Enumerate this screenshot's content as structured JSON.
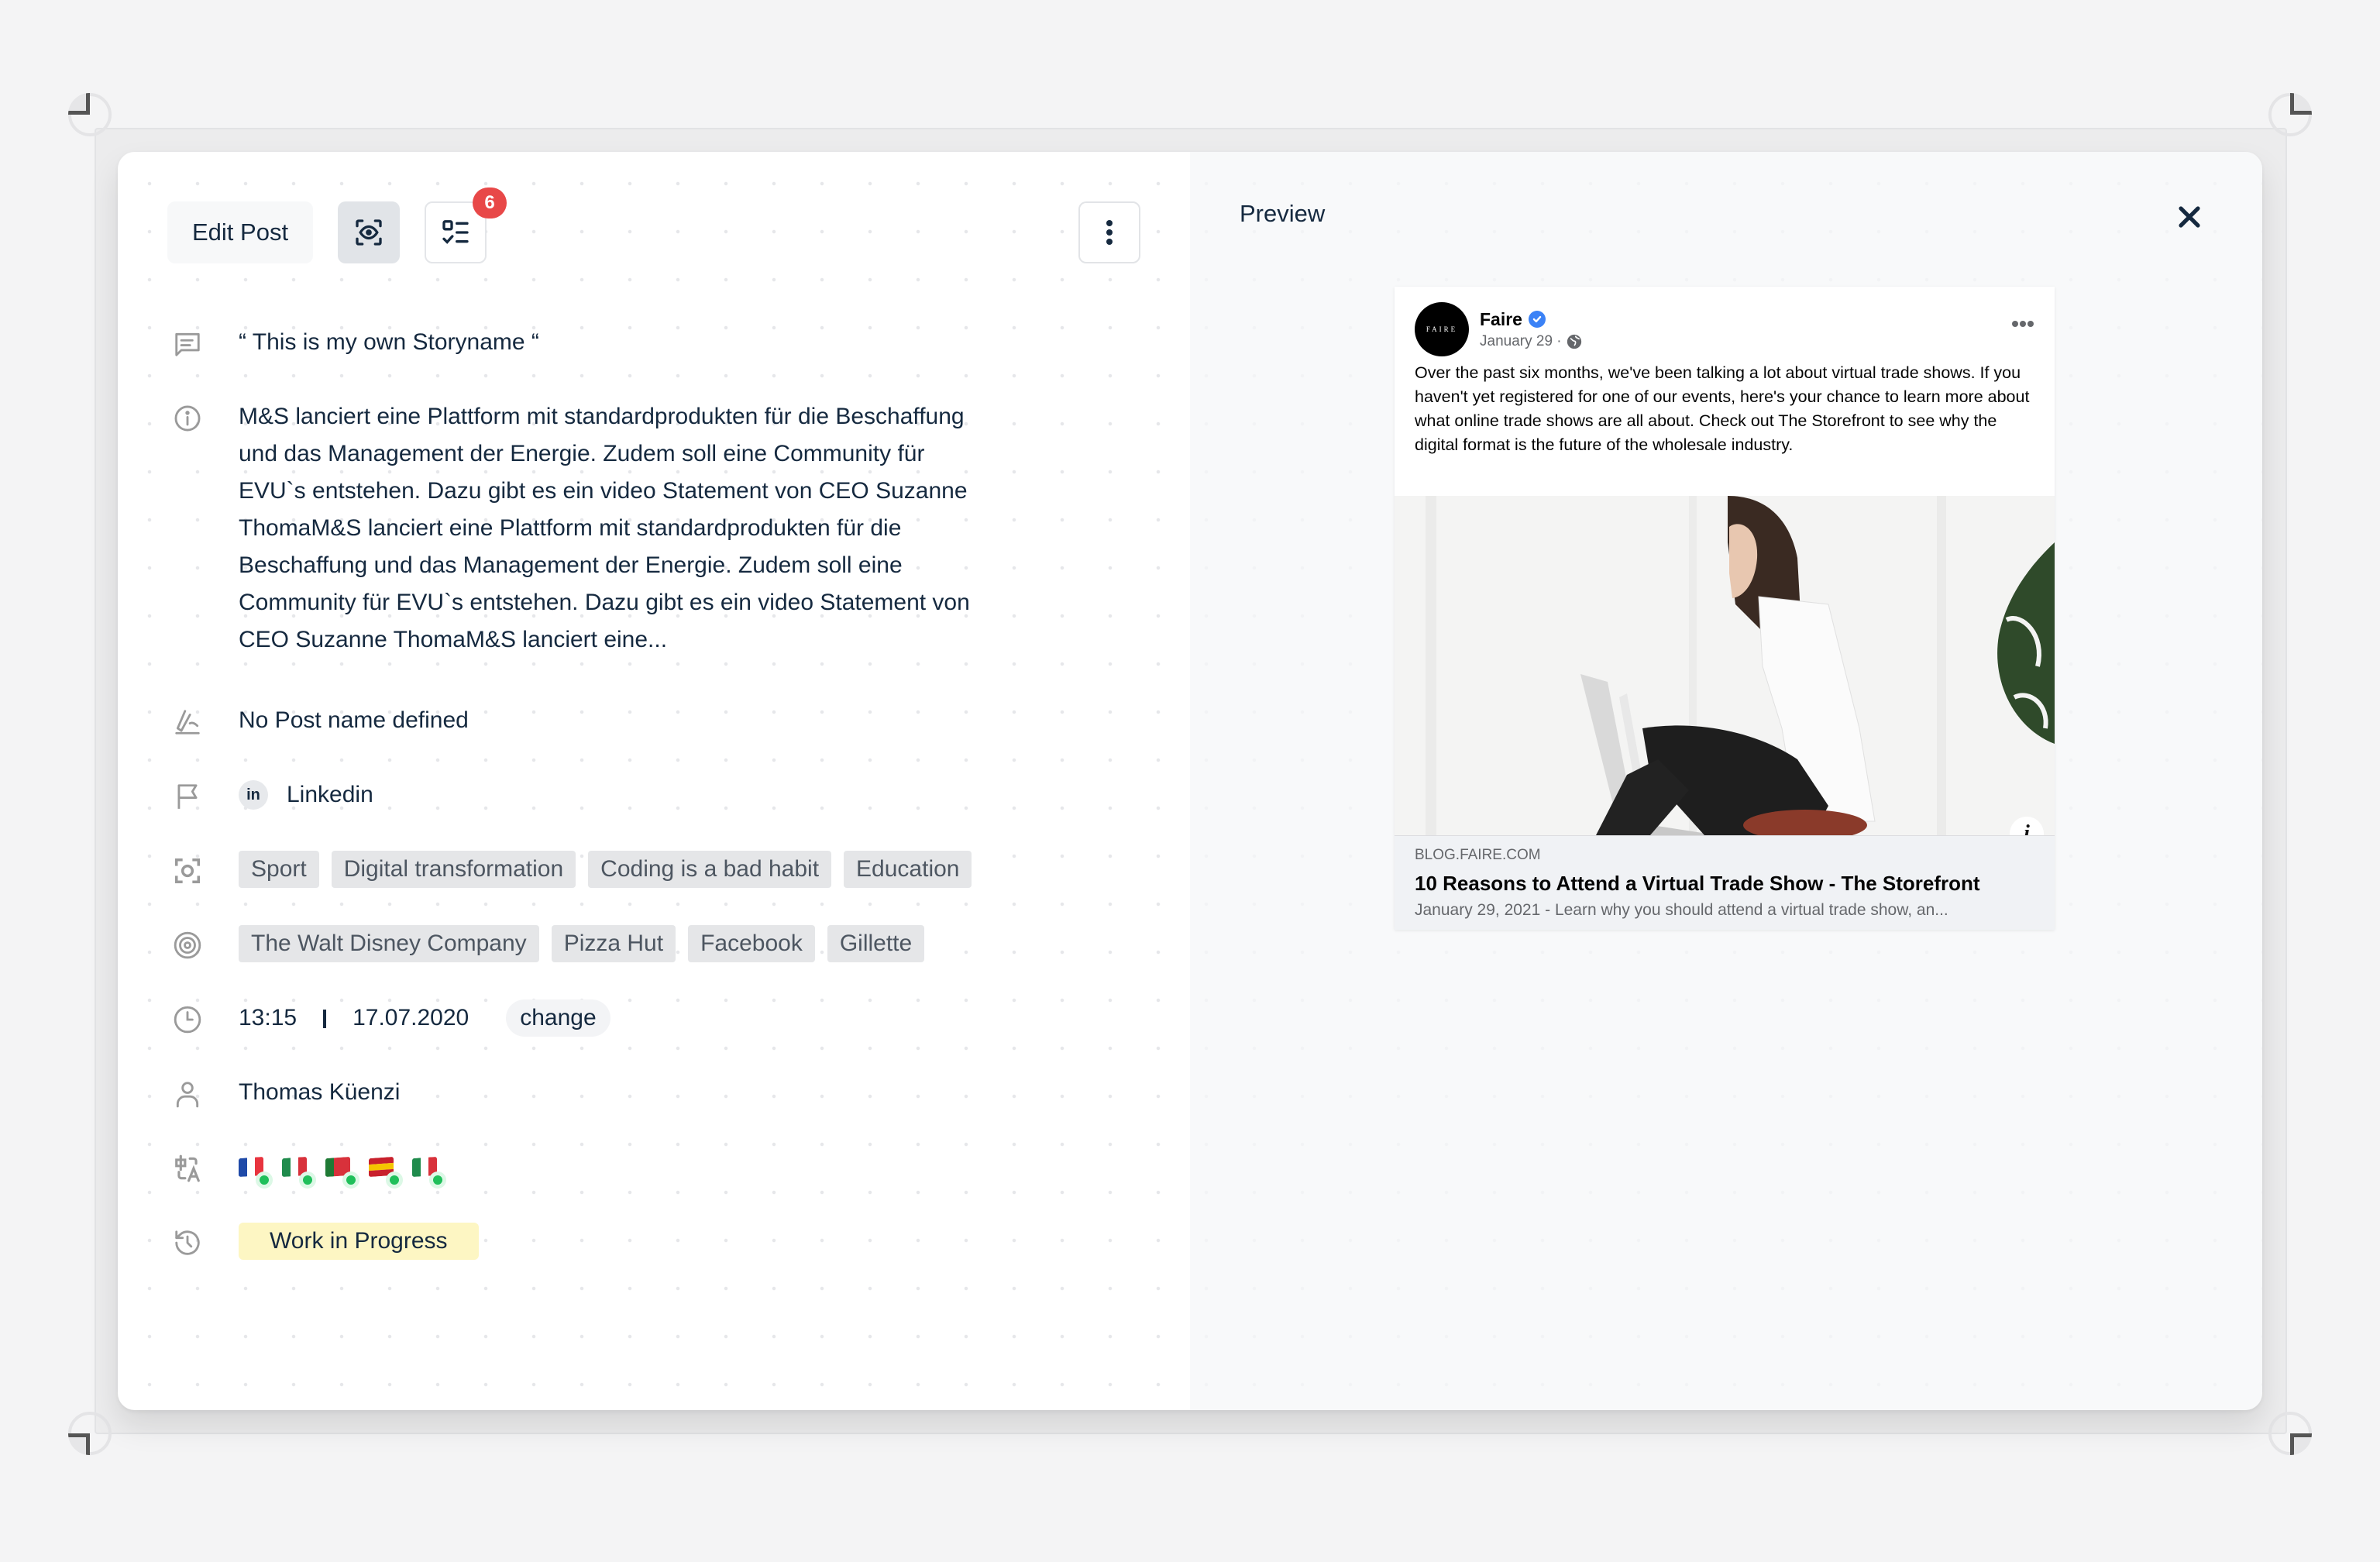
{
  "toolbar": {
    "edit_post_label": "Edit Post",
    "preview_icon": "eye-scan-icon",
    "checklist_icon": "checklist-icon",
    "checklist_badge_count": "6",
    "more_icon": "vertical-dots-icon"
  },
  "details": {
    "story_name": "“ This is my own Storyname “",
    "description": "M&S lanciert eine Plattform mit standardprodukten für die Beschaffung und das Management der Energie. Zudem soll eine Community für EVU`s entstehen. Dazu gibt es ein video Statement von CEO Suzanne ThomaM&S lanciert eine Plattform mit standardprodukten für die Beschaffung und das Management der Energie. Zudem soll eine Community für EVU`s entstehen. Dazu gibt es ein video Statement von CEO Suzanne ThomaM&S lanciert eine...",
    "post_name": "No Post name defined",
    "channel": {
      "icon_text": "in",
      "label": "Linkedin"
    },
    "topics": [
      "Sport",
      "Digital transformation",
      "Coding is a bad habit",
      "Education"
    ],
    "targets": [
      "The Walt Disney Company",
      "Pizza Hut",
      "Facebook",
      "Gillette"
    ],
    "time": "13:15",
    "date": "17.07.2020",
    "change_label": "change",
    "author": "Thomas Küenzi",
    "languages": [
      {
        "code": "fr",
        "status": "ready",
        "colors": [
          "#1f4aa8",
          "#ffffff",
          "#e8343f"
        ]
      },
      {
        "code": "it",
        "status": "ready",
        "colors": [
          "#1f8b4c",
          "#ffffff",
          "#d8313b"
        ]
      },
      {
        "code": "pt",
        "status": "ready",
        "colors": [
          "#1f7a35",
          "#d8313b",
          "#d8313b"
        ]
      },
      {
        "code": "es",
        "status": "ready",
        "colors": [
          "#c8202c",
          "#f5c400",
          "#c8202c"
        ]
      },
      {
        "code": "it",
        "status": "ready",
        "colors": [
          "#1f8b4c",
          "#ffffff",
          "#d8313b"
        ]
      }
    ],
    "status": "Work in Progress"
  },
  "preview": {
    "title": "Preview",
    "close_icon": "close-icon",
    "post": {
      "page_name": "Faire",
      "avatar_text": "FAIRE",
      "date": "January 29 ·",
      "text": "Over the past six months, we've been talking a lot about virtual trade shows. If you haven't yet registered for one of our events, here's your chance to learn more about what online trade shows are all about. Check out The Storefront to see why the digital format is the future of the wholesale industry.",
      "link_domain": "BLOG.FAIRE.COM",
      "link_title": "10 Reasons to Attend a Virtual Trade Show - The Storefront",
      "link_description": "January 29, 2021 - Learn why you should attend a virtual trade show, an..."
    }
  },
  "colors": {
    "text_primary": "#15293f",
    "badge_red": "#e84848",
    "status_yellow": "#fdf6c3",
    "tag_bg": "#e5e6e8",
    "online_green": "#1fbf5a"
  }
}
